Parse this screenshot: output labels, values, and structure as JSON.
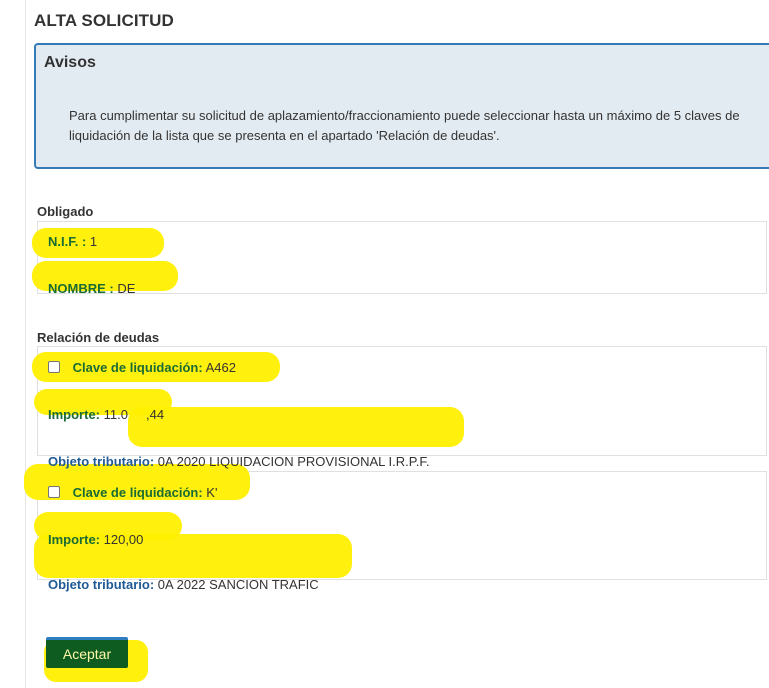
{
  "page": {
    "title": "ALTA SOLICITUD"
  },
  "notice": {
    "title": "Avisos",
    "text": "Para cumplimentar su solicitud de aplazamiento/fraccionamiento puede seleccionar hasta un máximo de 5 claves de liquidación de la lista que se presenta en el apartado 'Relación de deudas'."
  },
  "obligado": {
    "label": "Obligado",
    "nif_label": "N.I.F. :",
    "nif_value": "1",
    "nombre_label": "NOMBRE :",
    "nombre_value": "DE"
  },
  "deudas": {
    "label": "Relación de deudas",
    "items": [
      {
        "clave_label": "Clave de liquidación:",
        "clave_value": "A462",
        "importe_label": "Importe:",
        "importe_value": "11.0     ,44",
        "objeto_label": "Objeto tributario:",
        "objeto_value": "0A 2020 LIQUIDACION PROVISIONAL I.R.P.F.",
        "checked": false
      },
      {
        "clave_label": "Clave de liquidación:",
        "clave_value": "K'",
        "importe_label": "Importe:",
        "importe_value": "120,00",
        "objeto_label": "Objeto tributario:",
        "objeto_value": "0A 2022 SANCION TRAFIC",
        "checked": false
      }
    ]
  },
  "actions": {
    "accept_label": "Aceptar"
  },
  "colors": {
    "highlight": "#ffef00",
    "notice_border": "#337ab7",
    "notice_bg": "#e3ebf2",
    "accent_green": "#0f5c21"
  }
}
